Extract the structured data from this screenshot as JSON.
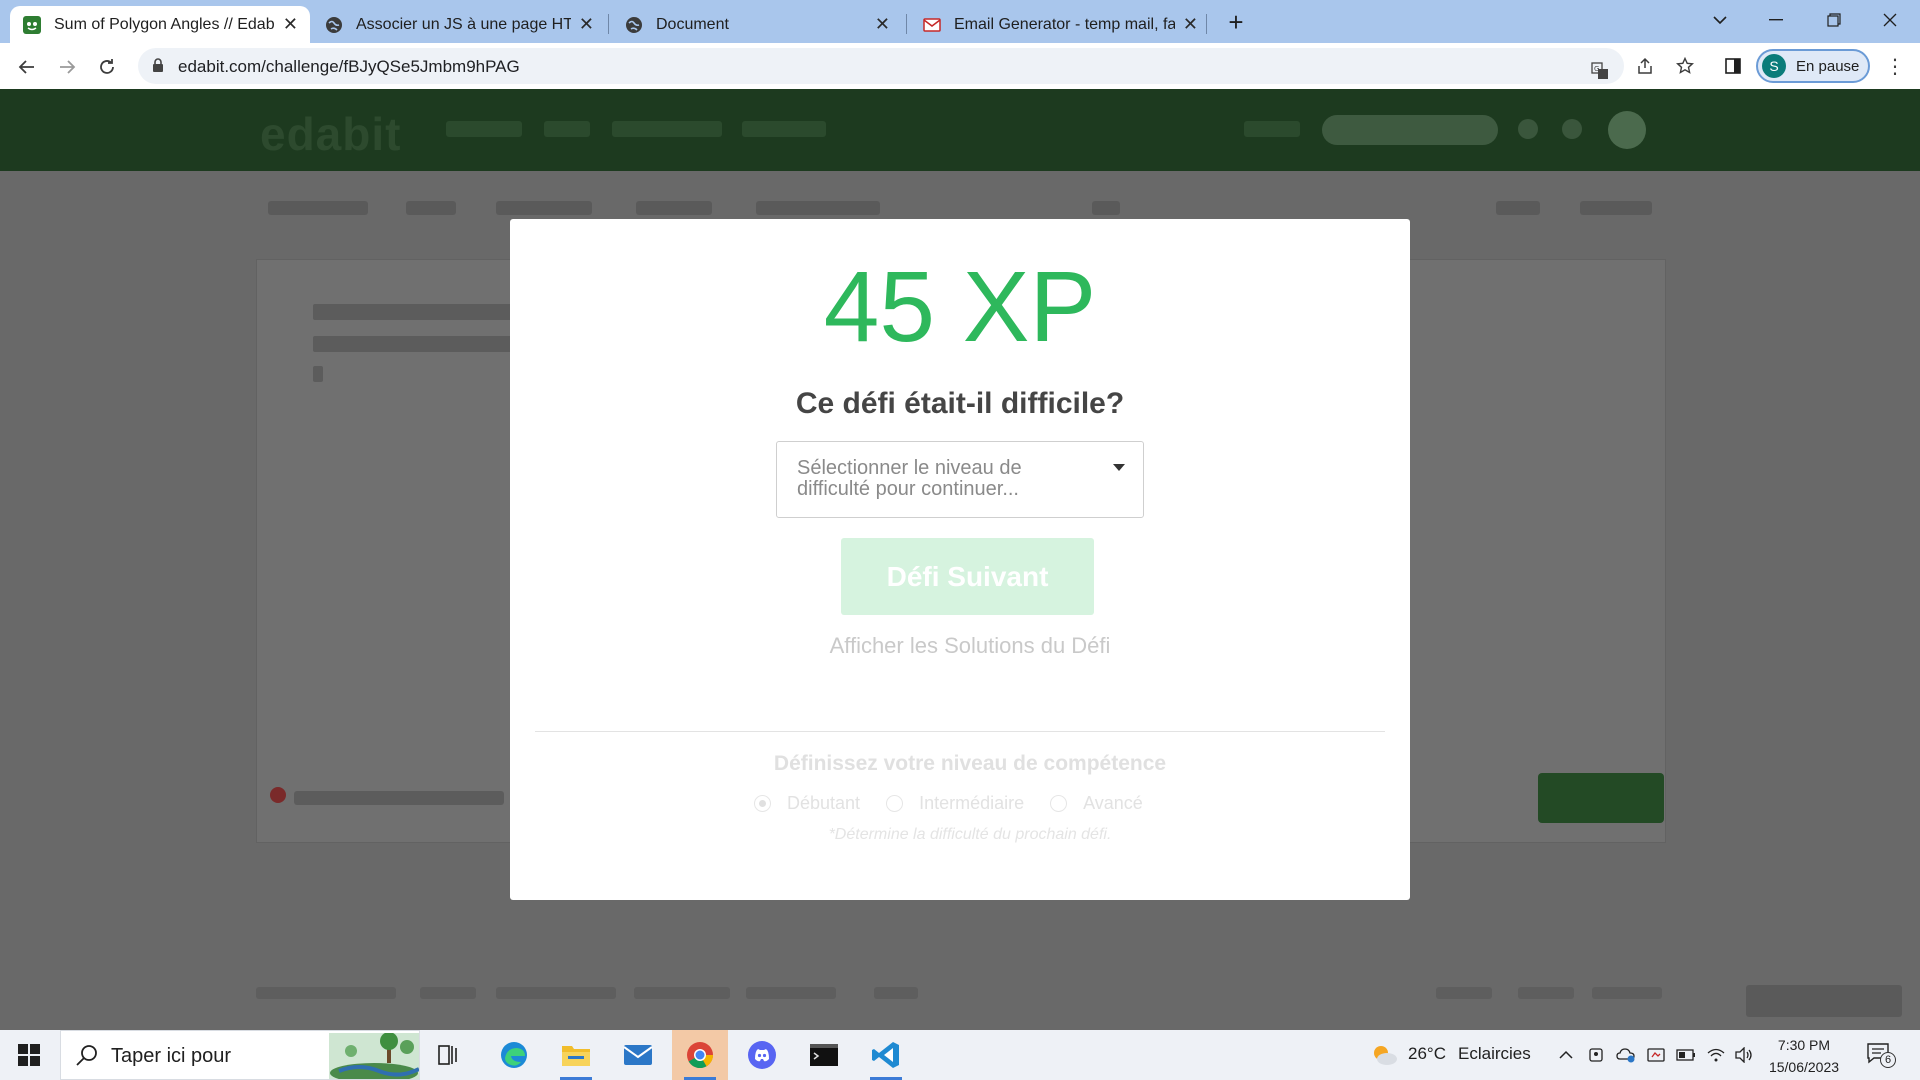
{
  "browser": {
    "tabs": [
      {
        "title": "Sum of Polygon Angles // Edabit",
        "active": true,
        "favicon": "edabit-icon"
      },
      {
        "title": "Associer un JS à une page HTML",
        "active": false,
        "favicon": "globe-icon"
      },
      {
        "title": "Document",
        "active": false,
        "favicon": "globe-icon"
      },
      {
        "title": "Email Generator - temp mail, fak",
        "active": false,
        "favicon": "mail-generator-icon"
      }
    ],
    "url": "edabit.com/challenge/fBJyQSe5Jmbm9hPAG",
    "profile": {
      "initial": "S",
      "label": "En pause"
    }
  },
  "modal": {
    "xp": "45 XP",
    "question": "Ce défi était-il difficile?",
    "select_placeholder": "Sélectionner le niveau de difficulté pour continuer...",
    "next_button": "Défi Suivant",
    "solutions_link": "Afficher les Solutions du Défi",
    "skill_title": "Définissez votre niveau de compétence",
    "skill_options": [
      {
        "label": "Débutant",
        "selected": true
      },
      {
        "label": "Intermédiaire",
        "selected": false
      },
      {
        "label": "Avancé",
        "selected": false
      }
    ],
    "hint": "*Détermine la difficulté du prochain défi."
  },
  "taskbar": {
    "search_placeholder": "Taper ici pour",
    "apps": [
      "task-view-icon",
      "edge-icon",
      "file-explorer-icon",
      "mail-icon",
      "chrome-icon",
      "discord-icon",
      "terminal-icon",
      "vscode-icon"
    ],
    "weather": {
      "temp": "26°C",
      "condition": "Eclaircies"
    },
    "clock": {
      "time": "7:30 PM",
      "date": "15/06/2023"
    },
    "notifications": "6"
  },
  "colors": {
    "xp_green": "#2eb85c",
    "button_disabled": "#d6f3df",
    "tabbar": "#a9c6ec",
    "header_dim": "#1d3a1f"
  }
}
